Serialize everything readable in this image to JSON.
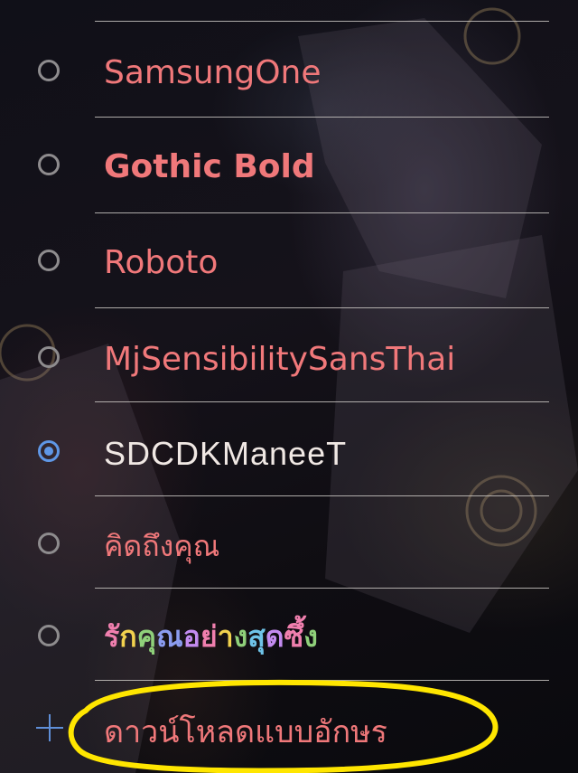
{
  "font_options": [
    {
      "label": "SamsungOne",
      "selected": false
    },
    {
      "label": "Gothic Bold",
      "selected": false
    },
    {
      "label": "Roboto",
      "selected": false
    },
    {
      "label": "MjSensibilitySansThai",
      "selected": false
    },
    {
      "label": "SDCDKManeeT",
      "selected": true
    },
    {
      "label": "คิดถึงคุณ",
      "selected": false
    },
    {
      "label": "รักคุณอย่างสุดซึ้ง",
      "selected": false
    }
  ],
  "download_fonts": {
    "label": "ดาวน์โหลดแบบอักษร",
    "icon": "plus-icon"
  },
  "colors": {
    "label_text": "#f0787a",
    "selected_text": "#f0e8e4",
    "radio_checked": "#5f97e6",
    "radio_unchecked": "#8e8c8e",
    "divider": "#c9c6c2",
    "highlight_circle": "#ffe600"
  },
  "rainbow_colors": [
    "#f07fae",
    "#f5a35c",
    "#f2d24e",
    "#8fd07a",
    "#6fc3e8",
    "#8b9cf0",
    "#c38bf0"
  ]
}
